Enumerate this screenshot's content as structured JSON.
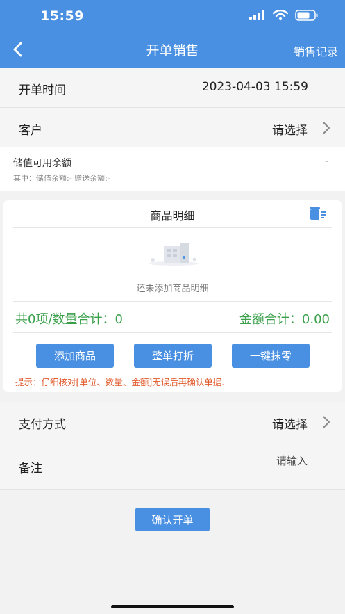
{
  "status_bar": {
    "time": "15:59"
  },
  "nav": {
    "title": "开单销售",
    "right_link": "销售记录"
  },
  "order_time": {
    "label": "开单时间",
    "value": "2023-04-03 15:59"
  },
  "customer": {
    "label": "客户",
    "value": "请选择"
  },
  "balance": {
    "title": "储值可用余额",
    "value": "-",
    "detail": "其中：储值余额:-    赠送余额:-"
  },
  "goods": {
    "title": "商品明细",
    "empty_text": "还未添加商品明细",
    "summary_left": "共0项/数量合计：0",
    "summary_right": "金额合计：0.00",
    "buttons": {
      "add": "添加商品",
      "discount": "整单打折",
      "round": "一键抹零"
    },
    "tip": "提示：仔细核对[单位、数量、金额]无误后再确认单据."
  },
  "payment": {
    "label": "支付方式",
    "value": "请选择"
  },
  "remark": {
    "label": "备注",
    "placeholder": "请输入"
  },
  "confirm_label": "确认开单",
  "colors": {
    "primary": "#4a90e2",
    "success": "#3aa04a",
    "warning": "#e05a2b"
  }
}
